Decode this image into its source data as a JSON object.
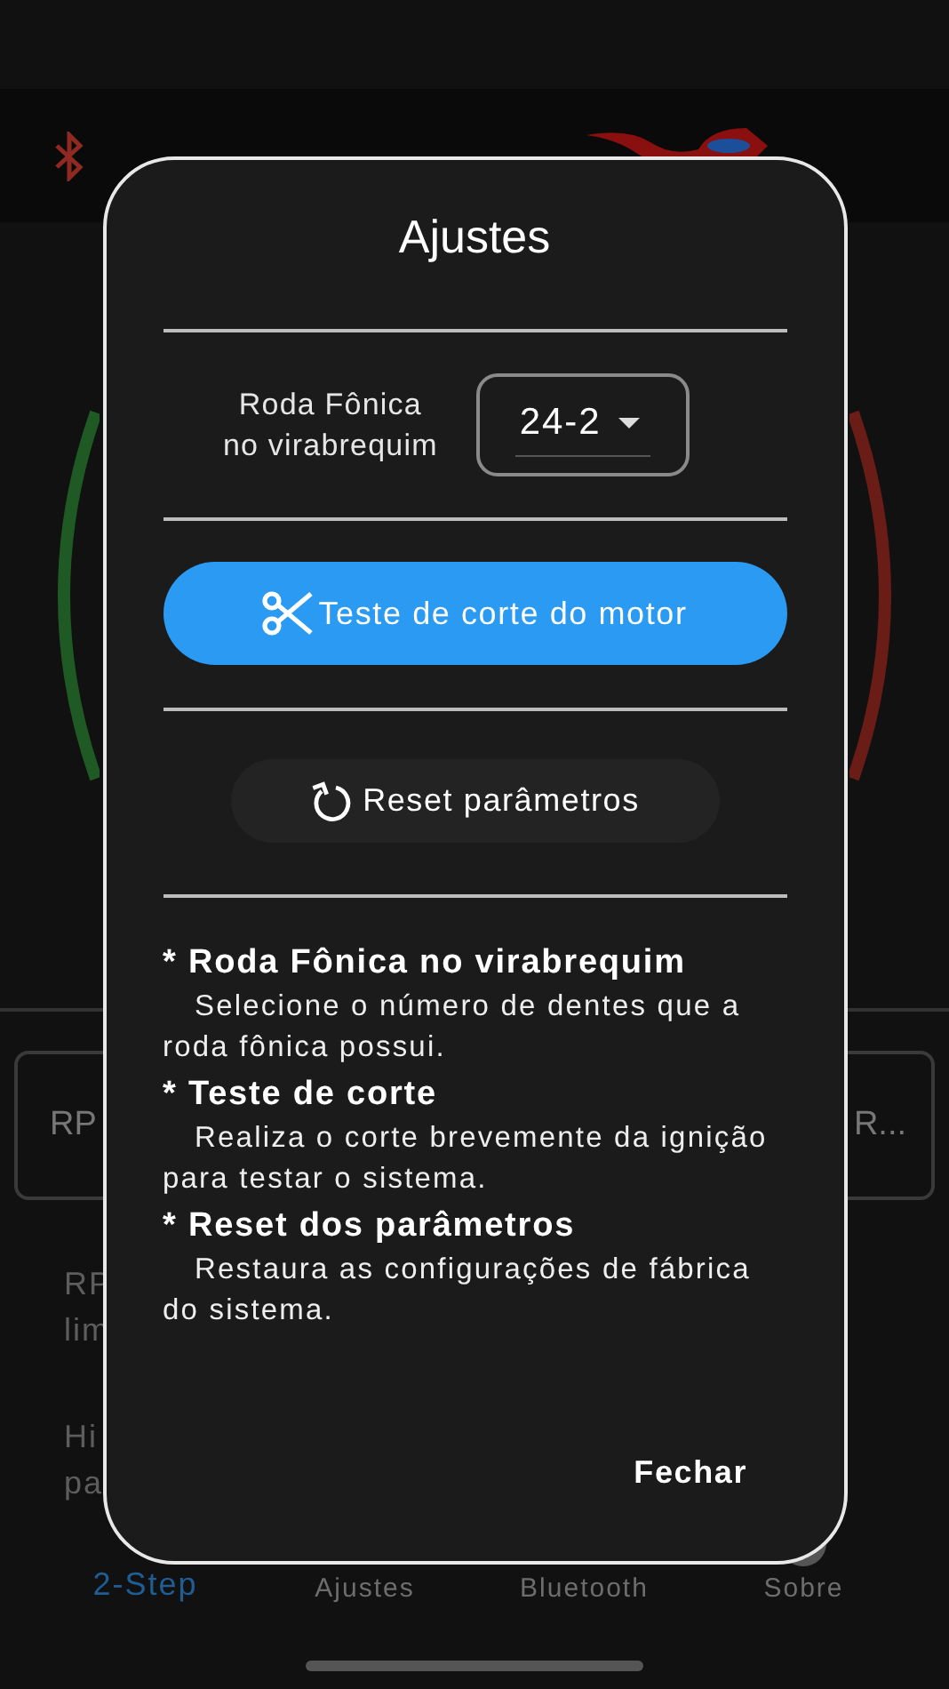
{
  "background": {
    "fields": [
      {
        "text": "RP"
      },
      {
        "text": "R..."
      }
    ],
    "notes": [
      {
        "lines": [
          "RP",
          "lim"
        ]
      },
      {
        "lines": [
          "Hi",
          "pa"
        ]
      }
    ],
    "bottom_nav": [
      {
        "label": "2-Step",
        "selected": true
      },
      {
        "label": "Ajustes",
        "selected": false
      },
      {
        "label": "Bluetooth",
        "selected": false
      },
      {
        "label": "Sobre",
        "selected": false
      }
    ]
  },
  "dialog": {
    "title": "Ajustes",
    "wheel_label": [
      "Roda Fônica",
      "no virabrequim"
    ],
    "wheel_value": "24-2",
    "test_button": "Teste de corte do motor",
    "reset_button": "Reset parâmetros",
    "help": [
      {
        "heading": "* Roda Fônica no virabrequim",
        "body": "Selecione o número de dentes que a roda fônica possui."
      },
      {
        "heading": "* Teste de corte",
        "body": "Realiza o corte brevemente da ignição para testar o sistema."
      },
      {
        "heading": "* Reset dos parâmetros",
        "body": "Restaura as configurações de fábrica do sistema."
      }
    ],
    "close_button": "Fechar"
  }
}
